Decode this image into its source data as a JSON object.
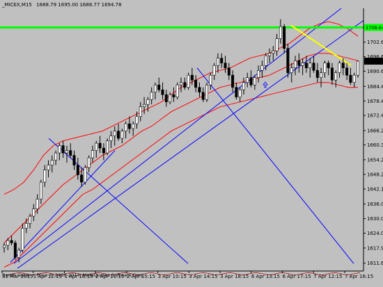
{
  "header": {
    "symbol": "_MICEX,M15",
    "ohlc": "1688.79 1695.00 1688.77 1694.78"
  },
  "copyright": "Bands Value + Price © 2000-2014, MetaQuotes Software Corp.",
  "colors": {
    "background": "#c0c0c0",
    "bull": "#ffffff",
    "bear": "#000000",
    "wick": "#000000",
    "bands": "#ff0000",
    "trendlines": "#0000ff",
    "resistance": "#00ff00",
    "yellow_line": "#ffff00",
    "current_price_box": "#000000"
  },
  "chart_data": {
    "type": "candlestick",
    "timeframe": "M15",
    "ylim": [
      1609.0,
      1716.5
    ],
    "y_ticks": [
      1611.65,
      1617.9,
      1624.0,
      1630.0,
      1636.0,
      1642.15,
      1648.2,
      1654.2,
      1660.3,
      1666.2,
      1672.45,
      1678.4,
      1684.4,
      1690.64,
      1696.6,
      1702.6,
      1708.7
    ],
    "x_ticks": [
      "31 Mar 2015",
      "1 Apr 12:15",
      "1 Apr 16:15",
      "2 Apr 11:15",
      "2 Apr 15:15",
      "3 Apr 10:15",
      "3 Apr 14:15",
      "3 Apr 18:15",
      "6 Apr 13:15",
      "6 Apr 17:15",
      "7 Apr 12:15",
      "7 Apr 16:15"
    ],
    "resistance_level": 1708.64,
    "current_price": 1694.78,
    "candles": [
      [
        1618,
        1620,
        1616,
        1619
      ],
      [
        1619,
        1622,
        1617,
        1621
      ],
      [
        1621,
        1623,
        1619,
        1620
      ],
      [
        1620,
        1621,
        1613,
        1614
      ],
      [
        1614,
        1618,
        1612,
        1617
      ],
      [
        1617,
        1628,
        1616,
        1626
      ],
      [
        1626,
        1630,
        1624,
        1628
      ],
      [
        1628,
        1632,
        1626,
        1631
      ],
      [
        1631,
        1636,
        1629,
        1634
      ],
      [
        1634,
        1640,
        1632,
        1638
      ],
      [
        1638,
        1646,
        1636,
        1645
      ],
      [
        1645,
        1652,
        1643,
        1650
      ],
      [
        1650,
        1654,
        1647,
        1652
      ],
      [
        1652,
        1656,
        1649,
        1654
      ],
      [
        1654,
        1658,
        1652,
        1657
      ],
      [
        1657,
        1661,
        1654,
        1660
      ],
      [
        1660,
        1662,
        1655,
        1657
      ],
      [
        1657,
        1660,
        1653,
        1658
      ],
      [
        1658,
        1661,
        1655,
        1656
      ],
      [
        1656,
        1658,
        1650,
        1652
      ],
      [
        1652,
        1655,
        1646,
        1648
      ],
      [
        1648,
        1651,
        1643,
        1645
      ],
      [
        1645,
        1652,
        1644,
        1651
      ],
      [
        1651,
        1656,
        1649,
        1655
      ],
      [
        1655,
        1660,
        1653,
        1658
      ],
      [
        1658,
        1662,
        1655,
        1661
      ],
      [
        1661,
        1664,
        1657,
        1659
      ],
      [
        1659,
        1661,
        1654,
        1657
      ],
      [
        1657,
        1663,
        1656,
        1662
      ],
      [
        1662,
        1666,
        1659,
        1664
      ],
      [
        1664,
        1668,
        1660,
        1666
      ],
      [
        1666,
        1669,
        1662,
        1663
      ],
      [
        1663,
        1667,
        1661,
        1666
      ],
      [
        1666,
        1670,
        1663,
        1669
      ],
      [
        1669,
        1672,
        1665,
        1667
      ],
      [
        1667,
        1670,
        1664,
        1669
      ],
      [
        1669,
        1674,
        1667,
        1672
      ],
      [
        1672,
        1678,
        1670,
        1676
      ],
      [
        1676,
        1680,
        1673,
        1677
      ],
      [
        1677,
        1680,
        1674,
        1679
      ],
      [
        1679,
        1684,
        1677,
        1682
      ],
      [
        1682,
        1686,
        1679,
        1685
      ],
      [
        1685,
        1688,
        1682,
        1683
      ],
      [
        1683,
        1686,
        1679,
        1681
      ],
      [
        1681,
        1683,
        1676,
        1678
      ],
      [
        1678,
        1682,
        1677,
        1681
      ],
      [
        1681,
        1684,
        1678,
        1680
      ],
      [
        1680,
        1686,
        1679,
        1685
      ],
      [
        1685,
        1688,
        1682,
        1686
      ],
      [
        1686,
        1688,
        1683,
        1684
      ],
      [
        1684,
        1690,
        1683,
        1689
      ],
      [
        1689,
        1692,
        1685,
        1687
      ],
      [
        1687,
        1689,
        1682,
        1684
      ],
      [
        1684,
        1686,
        1680,
        1682
      ],
      [
        1682,
        1684,
        1678,
        1679
      ],
      [
        1679,
        1686,
        1678,
        1685
      ],
      [
        1685,
        1690,
        1683,
        1689
      ],
      [
        1689,
        1694,
        1687,
        1693
      ],
      [
        1693,
        1698,
        1690,
        1696
      ],
      [
        1696,
        1698,
        1692,
        1694
      ],
      [
        1694,
        1697,
        1690,
        1692
      ],
      [
        1692,
        1694,
        1687,
        1689
      ],
      [
        1689,
        1691,
        1682,
        1684
      ],
      [
        1684,
        1686,
        1679,
        1680
      ],
      [
        1680,
        1684,
        1678,
        1683
      ],
      [
        1683,
        1688,
        1681,
        1686
      ],
      [
        1686,
        1690,
        1684,
        1688
      ],
      [
        1688,
        1691,
        1684,
        1685
      ],
      [
        1685,
        1689,
        1683,
        1688
      ],
      [
        1688,
        1693,
        1686,
        1691
      ],
      [
        1691,
        1695,
        1688,
        1693
      ],
      [
        1693,
        1698,
        1691,
        1697
      ],
      [
        1697,
        1700,
        1694,
        1698
      ],
      [
        1698,
        1701,
        1695,
        1699
      ],
      [
        1699,
        1706,
        1697,
        1704
      ],
      [
        1704,
        1712,
        1702,
        1709
      ],
      [
        1709,
        1710,
        1698,
        1700
      ],
      [
        1700,
        1702,
        1688,
        1690
      ],
      [
        1690,
        1694,
        1686,
        1692
      ],
      [
        1692,
        1697,
        1689,
        1695
      ],
      [
        1695,
        1698,
        1690,
        1693
      ],
      [
        1693,
        1696,
        1689,
        1694
      ],
      [
        1694,
        1697,
        1690,
        1692
      ],
      [
        1692,
        1696,
        1688,
        1694
      ],
      [
        1694,
        1697,
        1690,
        1691
      ],
      [
        1691,
        1694,
        1686,
        1688
      ],
      [
        1688,
        1692,
        1684,
        1690
      ],
      [
        1690,
        1695,
        1688,
        1694
      ],
      [
        1694,
        1695,
        1689,
        1692
      ],
      [
        1692,
        1694,
        1685,
        1687
      ],
      [
        1687,
        1691,
        1684,
        1690
      ],
      [
        1690,
        1695,
        1688,
        1694
      ],
      [
        1694,
        1696,
        1689,
        1692
      ],
      [
        1692,
        1694,
        1687,
        1689
      ],
      [
        1689,
        1692,
        1685,
        1686
      ],
      [
        1686,
        1690,
        1684,
        1689
      ],
      [
        1689,
        1695,
        1688,
        1694.78
      ]
    ],
    "bands": {
      "upper": [
        1640,
        1642,
        1645,
        1650,
        1656,
        1660,
        1662,
        1663,
        1664,
        1665,
        1666,
        1668,
        1670,
        1672,
        1674,
        1676,
        1678,
        1681,
        1684,
        1686,
        1688,
        1690,
        1691,
        1692,
        1694,
        1696,
        1697,
        1698,
        1700,
        1702,
        1705,
        1708,
        1710,
        1711,
        1710,
        1708,
        1705
      ],
      "middle": [
        1620,
        1624,
        1628,
        1632,
        1636,
        1640,
        1644,
        1647,
        1650,
        1653,
        1656,
        1658,
        1660,
        1663,
        1666,
        1668,
        1671,
        1674,
        1676,
        1678,
        1680,
        1682,
        1684,
        1685,
        1686,
        1687,
        1688,
        1689,
        1691,
        1693,
        1695,
        1697,
        1698,
        1698,
        1697,
        1696,
        1695
      ],
      "lower": [
        1610,
        1612,
        1616,
        1620,
        1624,
        1628,
        1632,
        1636,
        1640,
        1642,
        1645,
        1648,
        1651,
        1654,
        1657,
        1660,
        1663,
        1666,
        1668,
        1670,
        1672,
        1674,
        1676,
        1677,
        1678,
        1679,
        1680,
        1681,
        1682,
        1683,
        1684,
        1685,
        1686,
        1686,
        1685,
        1684,
        1684
      ]
    }
  }
}
